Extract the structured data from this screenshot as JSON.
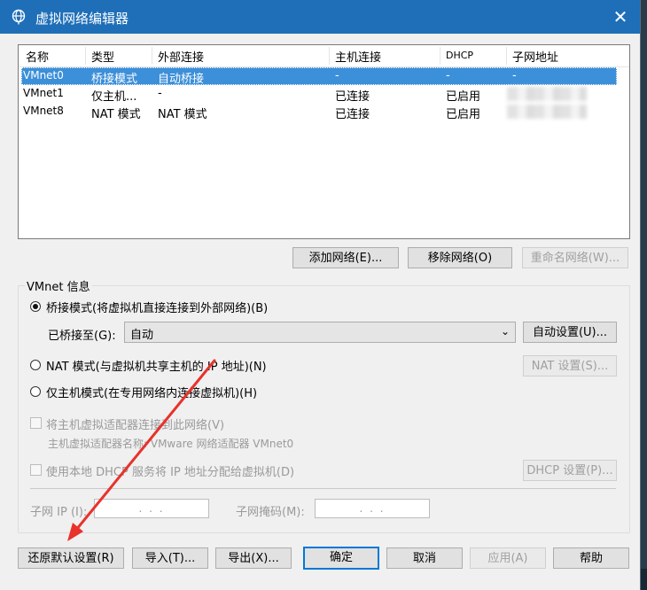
{
  "window": {
    "title": "虚拟网络编辑器",
    "close_glyph": "✕"
  },
  "list": {
    "headers": [
      "名称",
      "类型",
      "外部连接",
      "主机连接",
      "DHCP",
      "子网地址"
    ],
    "rows": [
      [
        "VMnet0",
        "桥接模式",
        "自动桥接",
        "-",
        "-",
        "-"
      ],
      [
        "VMnet1",
        "仅主机...",
        "-",
        "已连接",
        "已启用",
        ""
      ],
      [
        "VMnet8",
        "NAT 模式",
        "NAT 模式",
        "已连接",
        "已启用",
        ""
      ]
    ]
  },
  "net_buttons": {
    "add": "添加网络(E)...",
    "add_key": "E",
    "remove": "移除网络(O)",
    "remove_key": "O",
    "rename": "重命名网络(W)...",
    "rename_key": "W"
  },
  "info": {
    "group_label": "VMnet 信息",
    "bridged_label": "桥接模式(将虚拟机直接连接到外部网络)(B)",
    "bridged_to_label": "已桥接至(G):",
    "bridged_to_value": "自动",
    "auto_settings": "自动设置(U)...",
    "nat_label": "NAT 模式(与虚拟机共享主机的 IP 地址)(N)",
    "nat_settings": "NAT 设置(S)...",
    "hostonly_label": "仅主机模式(在专用网络内连接虚拟机)(H)",
    "connect_adapter_label": "将主机虚拟适配器连接到此网络(V)",
    "adapter_name_label": "主机虚拟适配器名称: VMware 网络适配器 VMnet0",
    "dhcp_label": "使用本地 DHCP 服务将 IP 地址分配给虚拟机(D)",
    "dhcp_settings": "DHCP 设置(P)...",
    "subnet_ip_label": "子网 IP (I):",
    "subnet_mask_label": "子网掩码(M):",
    "ip_placeholder": ".   .   .",
    "selected_mode": "bridged"
  },
  "footer": {
    "restore": "还原默认设置(R)",
    "import": "导入(T)...",
    "export": "导出(X)...",
    "ok": "确定",
    "cancel": "取消",
    "apply": "应用(A)",
    "help": "帮助"
  },
  "colors": {
    "titlebar": "#1e6fb8",
    "selection": "#3c8fd9",
    "annotation_arrow": "#e8322b"
  }
}
